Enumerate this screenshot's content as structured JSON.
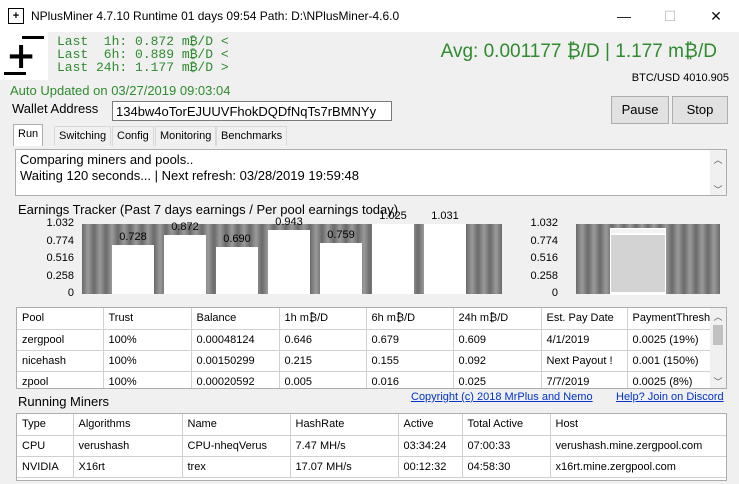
{
  "window": {
    "title": "NPlusMiner 4.7.10 Runtime 01 days 09:54 Path: D:\\NPlusMiner-4.6.0",
    "minimize": "—",
    "maximize": "☐",
    "close": "✕"
  },
  "stats": {
    "last1h": "Last  1h: 0.872 m₿/D <",
    "last6h": "Last  6h: 0.889 m₿/D <",
    "last24h": "Last 24h: 1.177 m₿/D >",
    "avg": "Avg: 0.001177 ₿/D   |   1.177 m₿/D",
    "btcusd": "BTC/USD 4010.905",
    "auto_updated": "Auto Updated on 03/27/2019 09:03:04"
  },
  "wallet": {
    "label": "Wallet Address",
    "value": "134bw4oTorEJUUVFhokDQDfNqTs7rBMNYy"
  },
  "buttons": {
    "pause": "Pause",
    "stop": "Stop"
  },
  "tabs": [
    "Run",
    "Switching",
    "Config",
    "Monitoring",
    "Benchmarks"
  ],
  "log": {
    "line1": "Comparing miners and pools..",
    "line2": "Waiting 120 seconds... | Next refresh: 03/28/2019 19:59:48"
  },
  "earnings_title": "Earnings Tracker (Past 7 days earnings / Per pool earnings today)",
  "chart_data": [
    {
      "type": "bar",
      "title": "",
      "categories": [
        "",
        "",
        "",
        "",
        "",
        "",
        ""
      ],
      "values": [
        0.728,
        0.872,
        0.69,
        0.943,
        0.759,
        1.025,
        1.031
      ],
      "data_labels": [
        "0.728",
        "0.872",
        "0.690",
        "0.943",
        "0.759",
        "1.025",
        "1.031"
      ],
      "yticks": [
        "1.032",
        "0.774",
        "0.516",
        "0.258",
        "0"
      ],
      "ylim": [
        0,
        1.032
      ],
      "grid": false
    },
    {
      "type": "bar",
      "title": "",
      "stacked": true,
      "categories": [
        ""
      ],
      "series": [
        {
          "values": [
            0.018
          ]
        },
        {
          "values": [
            0.872
          ]
        },
        {
          "values": [
            0.088
          ]
        }
      ],
      "yticks": [
        "1.032",
        "0.774",
        "0.516",
        "0.258",
        "0"
      ],
      "ylim": [
        0,
        1.032
      ]
    }
  ],
  "pool_table": {
    "headers": [
      "Pool",
      "Trust",
      "Balance",
      "1h m₿/D",
      "6h m₿/D",
      "24h m₿/D",
      "Est. Pay Date",
      "PaymentThresho"
    ],
    "rows": [
      [
        "zergpool",
        "100%",
        "0.00048124",
        "0.646",
        "0.679",
        "0.609",
        "4/1/2019",
        "0.0025 (19%)"
      ],
      [
        "nicehash",
        "100%",
        "0.00150299",
        "0.215",
        "0.155",
        "0.092",
        "Next Payout !",
        "0.001 (150%)"
      ],
      [
        "zpool",
        "100%",
        "0.00020592",
        "0.005",
        "0.016",
        "0.025",
        "7/7/2019",
        "0.0025 (8%)"
      ]
    ]
  },
  "running_title": "Running Miners",
  "links": {
    "copyright": "Copyright (c) 2018 MrPlus and Nemo",
    "help": "Help? Join on Discord"
  },
  "miners_table": {
    "headers": [
      "Type",
      "Algorithms",
      "Name",
      "HashRate",
      "Active",
      "Total Active",
      "Host"
    ],
    "rows": [
      [
        "CPU",
        "verushash",
        "CPU-nheqVerus",
        "7.47 MH/s",
        "03:34:24",
        "07:00:33",
        "verushash.mine.zergpool.com"
      ],
      [
        "NVIDIA",
        "X16rt",
        "trex",
        "17.07 MH/s",
        "00:12:32",
        "04:58:30",
        "x16rt.mine.zergpool.com"
      ]
    ]
  }
}
